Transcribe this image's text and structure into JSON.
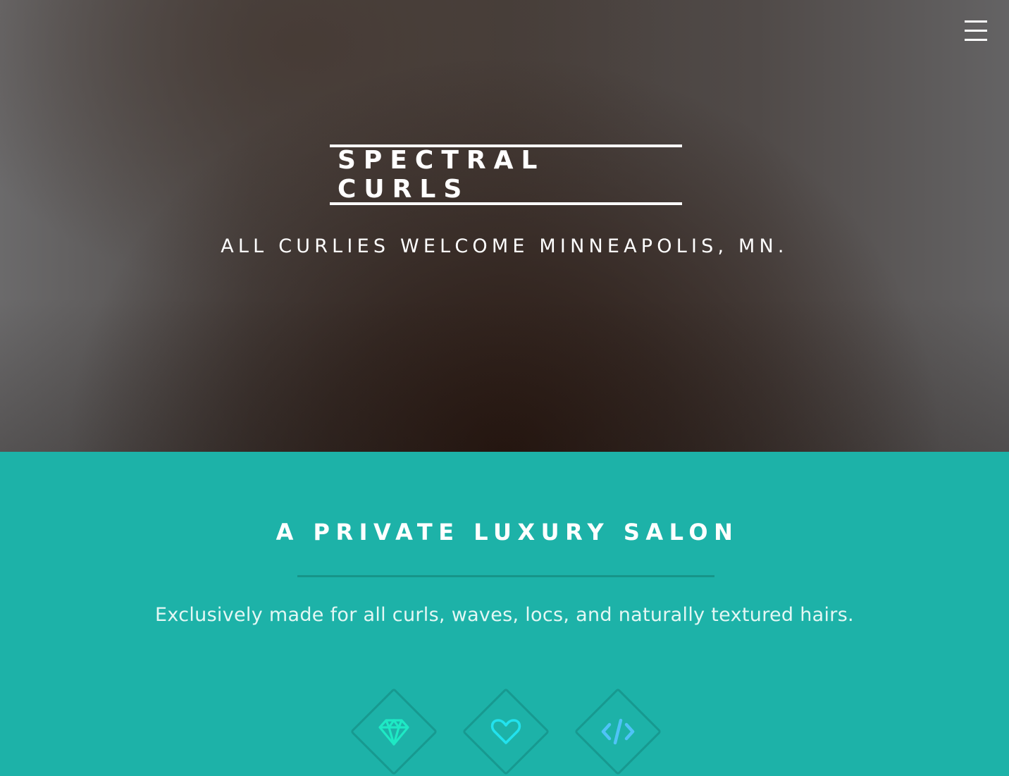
{
  "header": {
    "title": "SPECTRAL CURLS",
    "tagline": "ALL CURLIES WELCOME MINNEAPOLIS, MN.",
    "menu_icon": "hamburger-menu-icon"
  },
  "intro": {
    "heading": "A PRIVATE LUXURY SALON",
    "text": "Exclusively made for all curls, waves, locs, and naturally textured hairs.",
    "icons": [
      {
        "name": "diamond-icon",
        "color": "#1ee9c4"
      },
      {
        "name": "heart-icon",
        "color": "#22e2ee"
      },
      {
        "name": "code-icon",
        "color": "#4fc3f7"
      }
    ]
  },
  "colors": {
    "accent": "#1db2a8",
    "accent_dark": "#169589",
    "text_light": "#ffffff"
  }
}
